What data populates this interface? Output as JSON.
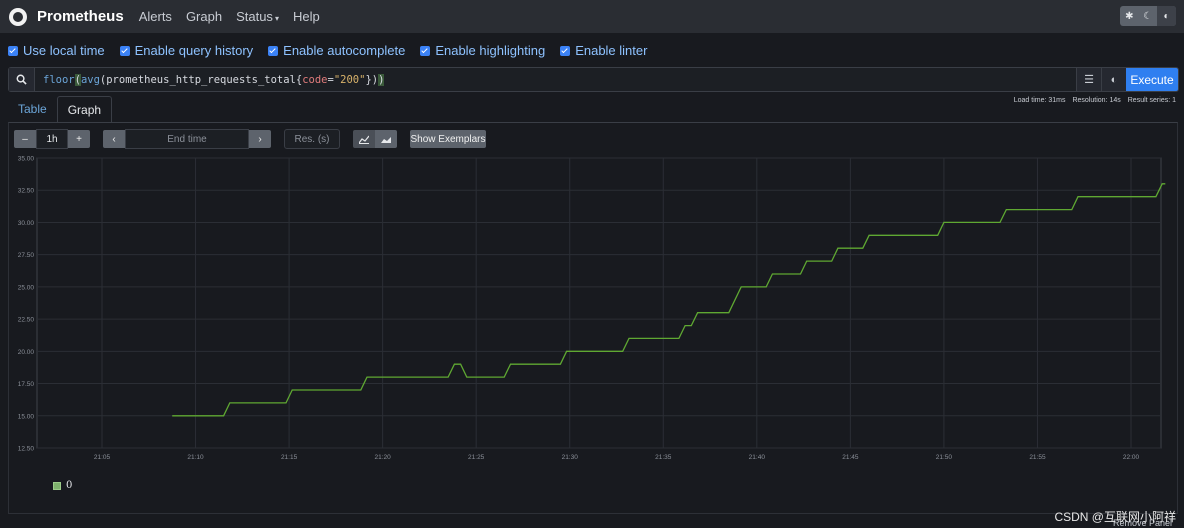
{
  "navbar": {
    "brand": "Prometheus",
    "items": [
      "Alerts",
      "Graph",
      "Status",
      "Help"
    ],
    "theme_buttons": [
      "gear-icon",
      "moon-icon",
      "contrast-icon"
    ]
  },
  "options": [
    {
      "label": "Use local time",
      "checked": true
    },
    {
      "label": "Enable query history",
      "checked": true
    },
    {
      "label": "Enable autocomplete",
      "checked": true
    },
    {
      "label": "Enable highlighting",
      "checked": true
    },
    {
      "label": "Enable linter",
      "checked": true
    }
  ],
  "query": {
    "fn_floor": "floor",
    "fn_avg": "avg",
    "metric": "prometheus_http_requests_total",
    "label_name": "code",
    "label_value": "\"200\"",
    "execute_label": "Execute"
  },
  "stats": {
    "load_time": "Load time: 31ms",
    "resolution": "Resolution: 14s",
    "result_series": "Result series: 1"
  },
  "tabs": [
    "Table",
    "Graph"
  ],
  "active_tab": "Graph",
  "controls": {
    "minus": "–",
    "range": "1h",
    "plus": "+",
    "prev": "‹",
    "end_time_placeholder": "End time",
    "next": "›",
    "res_placeholder": "Res. (s)",
    "show_exemplars": "Show Exemplars"
  },
  "chart_data": {
    "type": "line",
    "x_ticks": [
      "21:05",
      "21:10",
      "21:15",
      "21:20",
      "21:25",
      "21:30",
      "21:35",
      "21:40",
      "21:45",
      "21:50",
      "21:55",
      "22:00"
    ],
    "y_ticks": [
      "12.50",
      "15.00",
      "17.50",
      "20.00",
      "22.50",
      "25.00",
      "27.50",
      "30.00",
      "32.50",
      "35.00"
    ],
    "ylim": [
      12.5,
      35
    ],
    "grid": true,
    "series": [
      {
        "name": "0",
        "color": "#7eb26d",
        "points": [
          [
            "21:08:45",
            15
          ],
          [
            "21:11:30",
            15
          ],
          [
            "21:11:50",
            16
          ],
          [
            "21:14:50",
            16
          ],
          [
            "21:15:10",
            17
          ],
          [
            "21:18:50",
            17
          ],
          [
            "21:19:10",
            18
          ],
          [
            "21:23:30",
            18
          ],
          [
            "21:23:50",
            19
          ],
          [
            "21:24:10",
            19
          ],
          [
            "21:24:30",
            18
          ],
          [
            "21:26:30",
            18
          ],
          [
            "21:26:50",
            19
          ],
          [
            "21:29:30",
            19
          ],
          [
            "21:29:50",
            20
          ],
          [
            "21:32:50",
            20
          ],
          [
            "21:33:10",
            21
          ],
          [
            "21:35:50",
            21
          ],
          [
            "21:36:10",
            22
          ],
          [
            "21:36:30",
            22
          ],
          [
            "21:36:50",
            23
          ],
          [
            "21:38:30",
            23
          ],
          [
            "21:39:10",
            25
          ],
          [
            "21:40:30",
            25
          ],
          [
            "21:40:50",
            26
          ],
          [
            "21:42:20",
            26
          ],
          [
            "21:42:40",
            27
          ],
          [
            "21:44:00",
            27
          ],
          [
            "21:44:20",
            28
          ],
          [
            "21:45:40",
            28
          ],
          [
            "21:46:00",
            29
          ],
          [
            "21:49:40",
            29
          ],
          [
            "21:50:00",
            30
          ],
          [
            "21:53:00",
            30
          ],
          [
            "21:53:20",
            31
          ],
          [
            "21:56:50",
            31
          ],
          [
            "21:57:10",
            32
          ],
          [
            "22:01:20",
            32
          ],
          [
            "22:01:40",
            33
          ],
          [
            "22:01:50",
            33
          ]
        ]
      }
    ]
  },
  "legend": [
    {
      "label": "0",
      "color": "#7eb26d"
    }
  ],
  "remove_panel": "Remove Panel",
  "watermark": "CSDN @互联网小阿祥"
}
